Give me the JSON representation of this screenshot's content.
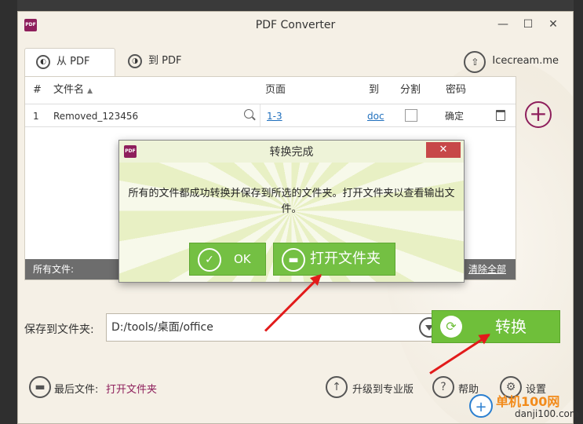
{
  "window": {
    "title": "PDF Converter",
    "app_icon_text": "PDF",
    "min": "—",
    "max": "☐",
    "close": "✕"
  },
  "tabs": [
    {
      "label": "从 PDF"
    },
    {
      "label": "到 PDF"
    }
  ],
  "brand": {
    "label": "Icecream.me"
  },
  "table": {
    "headers": {
      "num": "#",
      "name": "文件名",
      "pages": "页面",
      "to": "到",
      "split": "分割",
      "password": "密码"
    },
    "rows": [
      {
        "num": "1",
        "name": "Removed_123456",
        "pages": "1-3",
        "to": "doc",
        "password": "确定"
      }
    ],
    "footer": {
      "all_files": "所有文件:",
      "clear_all": "清除全部"
    }
  },
  "save": {
    "label": "保存到文件夹:",
    "path": "D:/tools/桌面/office"
  },
  "convert": {
    "label": "转换"
  },
  "bottom": {
    "recent_label": "最后文件:",
    "recent_link": "打开文件夹",
    "upgrade": "升级到专业版",
    "help": "帮助",
    "settings": "设置"
  },
  "dialog": {
    "title": "转换完成",
    "message": "所有的文件都成功转换并保存到所选的文件夹。打开文件夹以查看输出文件。",
    "ok": "OK",
    "open_folder": "打开文件夹",
    "close": "✕"
  },
  "watermark": {
    "main": "单机100网",
    "sub": "danji100.com"
  },
  "colors": {
    "accent": "#8e1f5c",
    "green": "#6fbf3a",
    "link": "#1f6fbd",
    "arrow": "#e21b1b"
  }
}
